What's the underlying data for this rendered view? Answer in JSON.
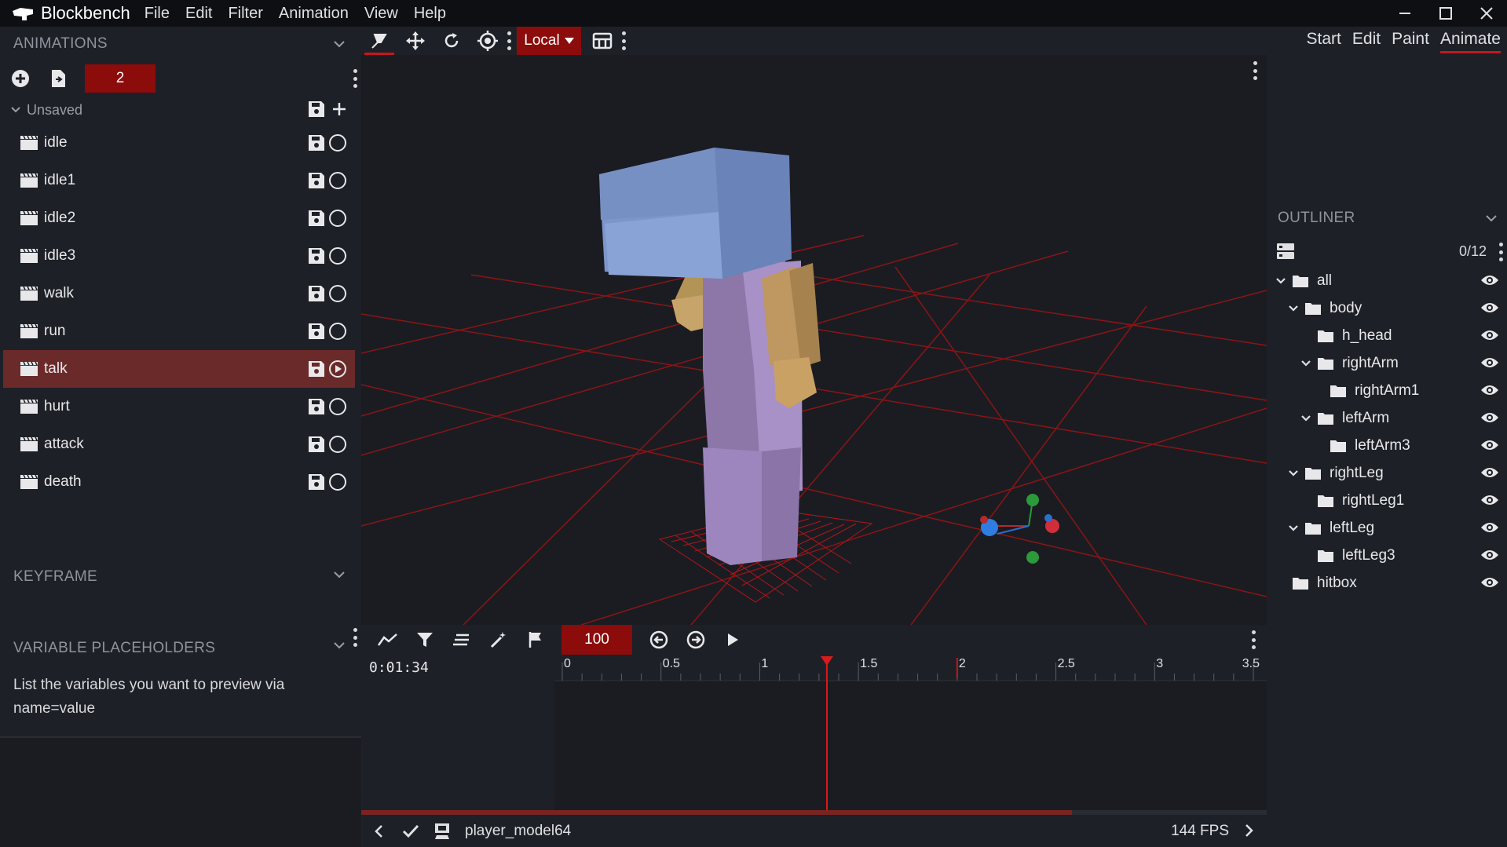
{
  "app": {
    "name": "Blockbench",
    "menu": [
      "File",
      "Edit",
      "Filter",
      "Animation",
      "View",
      "Help"
    ]
  },
  "animations_panel": {
    "title": "ANIMATIONS",
    "badge_value": "2",
    "group_label": "Unsaved",
    "items": [
      {
        "label": "idle",
        "playing": false
      },
      {
        "label": "idle1",
        "playing": false
      },
      {
        "label": "idle2",
        "playing": false
      },
      {
        "label": "idle3",
        "playing": false
      },
      {
        "label": "walk",
        "playing": false
      },
      {
        "label": "run",
        "playing": false
      },
      {
        "label": "talk",
        "playing": true,
        "selected": true
      },
      {
        "label": "hurt",
        "playing": false
      },
      {
        "label": "attack",
        "playing": false
      },
      {
        "label": "death",
        "playing": false
      }
    ]
  },
  "keyframe_panel": {
    "title": "KEYFRAME"
  },
  "variable_placeholders": {
    "title": "VARIABLE PLACEHOLDERS",
    "description": "List the variables you want to preview via name=value"
  },
  "toolbar": {
    "transform_space": "Local"
  },
  "mode_tabs": [
    {
      "label": "Start",
      "active": false
    },
    {
      "label": "Edit",
      "active": false
    },
    {
      "label": "Paint",
      "active": false
    },
    {
      "label": "Animate",
      "active": true
    }
  ],
  "outliner": {
    "title": "OUTLINER",
    "count": "0/12",
    "nodes": [
      {
        "label": "all",
        "depth": 0,
        "expanded": true
      },
      {
        "label": "body",
        "depth": 1,
        "expanded": true
      },
      {
        "label": "h_head",
        "depth": 2,
        "expanded": null
      },
      {
        "label": "rightArm",
        "depth": 2,
        "expanded": true
      },
      {
        "label": "rightArm1",
        "depth": 3,
        "expanded": null
      },
      {
        "label": "leftArm",
        "depth": 2,
        "expanded": true
      },
      {
        "label": "leftArm3",
        "depth": 3,
        "expanded": null
      },
      {
        "label": "rightLeg",
        "depth": 1,
        "expanded": true
      },
      {
        "label": "rightLeg1",
        "depth": 2,
        "expanded": null
      },
      {
        "label": "leftLeg",
        "depth": 1,
        "expanded": true
      },
      {
        "label": "leftLeg3",
        "depth": 2,
        "expanded": null
      },
      {
        "label": "hitbox",
        "depth": 0,
        "expanded": null
      }
    ]
  },
  "timeline": {
    "playback_speed": "100",
    "timecode": "0:01:34",
    "ticks": [
      "0",
      "0.5",
      "1",
      "1.5",
      "2",
      "2.5",
      "3",
      "3.5"
    ],
    "playhead_seconds": 1.34,
    "loop_marker_seconds": 2.0,
    "max_seconds": 3.5
  },
  "statusbar": {
    "model_name": "player_model64",
    "fps": "144 FPS"
  },
  "colors": {
    "accent": "#8c0b0b",
    "accent_line": "#c4181d",
    "panel": "#1e2027",
    "viewport": "#1b1c22"
  }
}
